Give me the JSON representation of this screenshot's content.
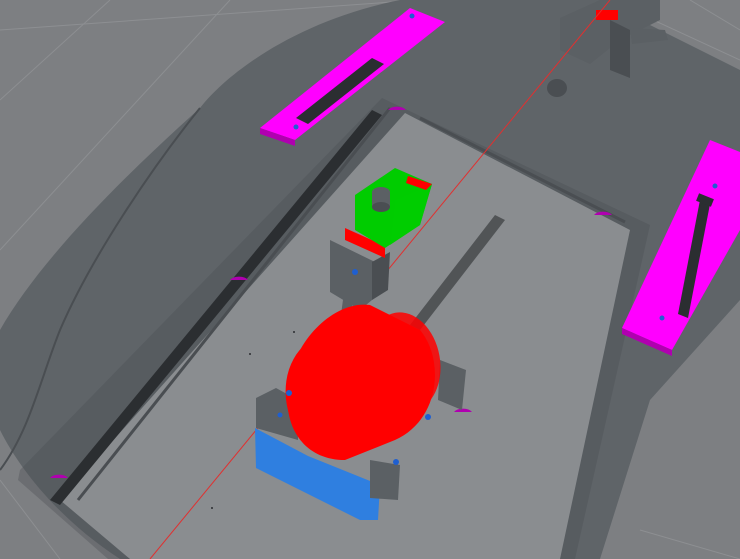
{
  "viewport": {
    "background_color": "#7d7f82",
    "grid_line_color": "#8d8f92",
    "chassis_color": "#5f6468",
    "chassis_edge_color": "#4a4e52",
    "bay_floor_color": "#8a8d90",
    "slot_color": "#2b2e31"
  },
  "components": {
    "magenta_plate_color": "#ff00ff",
    "motor_cylinder_color": "#ff0000",
    "motor_mount_color": "#2f7fe0",
    "servo_body_color": "#00cc00",
    "servo_accent_color": "#ff0000",
    "bracket_color": "#5b6064",
    "screw_color": "#1f5fd0",
    "axis_line_color": "#e03030",
    "hole_cutout_color": "#b000b0"
  }
}
